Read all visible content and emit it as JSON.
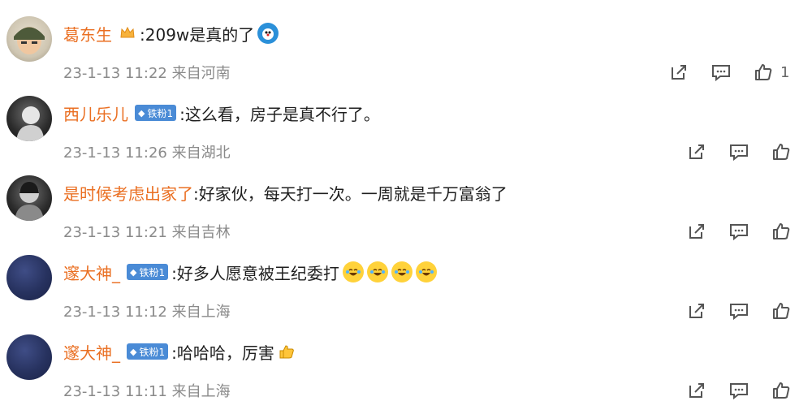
{
  "comments": [
    {
      "username": "葛东生",
      "avatar_style": "soldier",
      "badge": "",
      "text": ":209w是真的了",
      "emoji": "doraemon-emoji",
      "time": "23-1-13 11:22",
      "location": "来自河南",
      "like_count": "1"
    },
    {
      "username": "西儿乐儿",
      "avatar_style": "dark",
      "badge": "铁粉1",
      "text": ":这么看，房子是真不行了。",
      "time": "23-1-13 11:26",
      "location": "来自湖北",
      "like_count": ""
    },
    {
      "username": "是时候考虑出家了",
      "avatar_style": "dark",
      "badge": "",
      "text": ":好家伙，每天打一次。一周就是千万富翁了",
      "time": "23-1-13 11:21",
      "location": "来自吉林",
      "like_count": ""
    },
    {
      "username": "邃大神_",
      "avatar_style": "navy",
      "badge": "铁粉1",
      "text": ":好多人愿意被王纪委打",
      "emoji": "laughing-crying-emoji x4",
      "time": "23-1-13 11:12",
      "location": "来自上海",
      "like_count": ""
    },
    {
      "username": "邃大神_",
      "avatar_style": "navy",
      "badge": "铁粉1",
      "text": ":哈哈哈，厉害",
      "emoji": "thumbs-up-emoji",
      "time": "23-1-13 11:11",
      "location": "来自上海",
      "like_count": ""
    }
  ]
}
